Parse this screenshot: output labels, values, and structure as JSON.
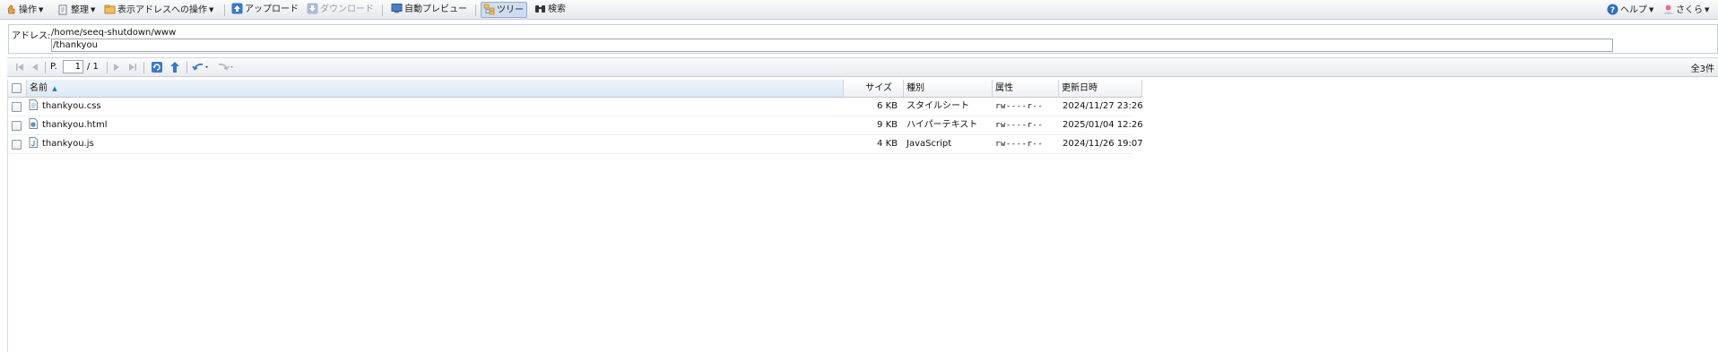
{
  "toolbar": {
    "operations": "操作",
    "organize": "整理",
    "address_ops": "表示アドレスへの操作",
    "upload": "アップロード",
    "download": "ダウンロード",
    "auto_preview": "自動プレビュー",
    "tree": "ツリー",
    "search": "検索",
    "help": "ヘルプ",
    "user": "さくら"
  },
  "address": {
    "label": "アドレス:",
    "base_path": "/home/seeq-shutdown/www",
    "current_path": "/thankyou"
  },
  "pager": {
    "page_label": "P.",
    "page_value": "1",
    "page_total": "/ 1",
    "total_count": "全3件"
  },
  "columns": {
    "name": "名前",
    "size": "サイズ",
    "type": "種別",
    "attr": "属性",
    "modified": "更新日時"
  },
  "files": [
    {
      "name": "thankyou.css",
      "size": "6 KB",
      "type": "スタイルシート",
      "attr": "rw----r--",
      "modified": "2024/11/27 23:26",
      "icon": "css-file-icon"
    },
    {
      "name": "thankyou.html",
      "size": "9 KB",
      "type": "ハイパーテキスト",
      "attr": "rw----r--",
      "modified": "2025/01/04 12:26",
      "icon": "html-file-icon"
    },
    {
      "name": "thankyou.js",
      "size": "4 KB",
      "type": "JavaScript",
      "attr": "rw----r--",
      "modified": "2024/11/26 19:07",
      "icon": "js-file-icon"
    }
  ],
  "colors": {
    "accent": "#2f6fbf",
    "tree_active_bg": "#cfdcf0"
  }
}
